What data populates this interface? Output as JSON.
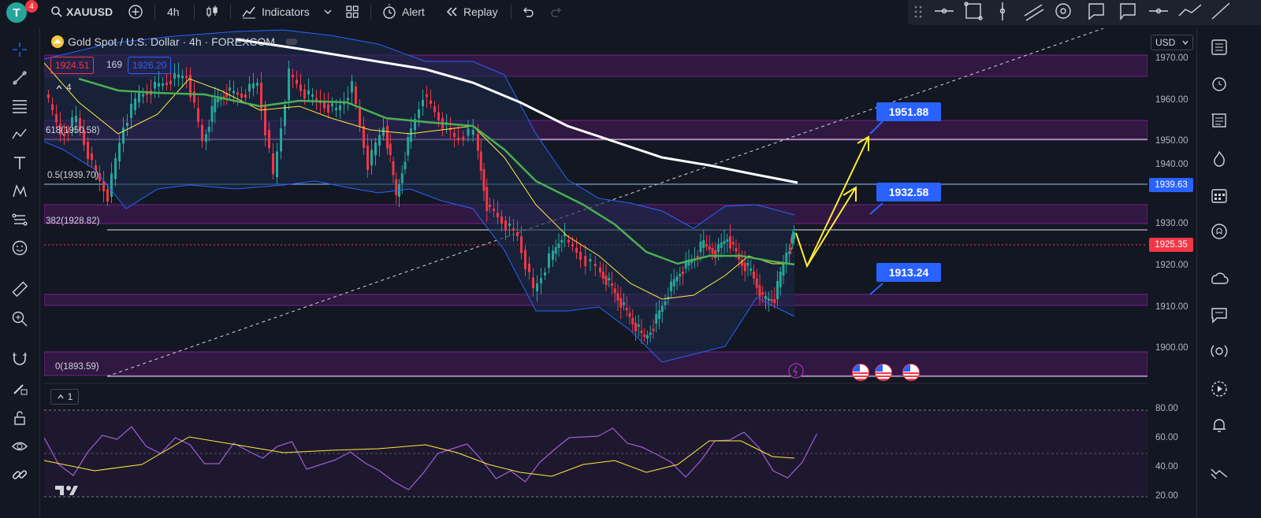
{
  "header": {
    "avatar_letter": "T",
    "notification_count": "4",
    "symbol": "XAUUSD",
    "interval": "4h",
    "indicators_label": "Indicators",
    "alert_label": "Alert",
    "replay_label": "Replay"
  },
  "legend": {
    "title": "Gold Spot / U.S. Dollar · 4h · FOREXCOM",
    "bid": "1924.51",
    "spread": "169",
    "ask": "1926.20",
    "indicator_count": "4"
  },
  "fib_labels": [
    "618(1950.58)",
    "0.5(1939.70)",
    "382(1928.82)",
    "0(1893.59)"
  ],
  "callouts": [
    "1951.88",
    "1932.58",
    "1913.24"
  ],
  "price_axis": {
    "currency": "USD",
    "ticks": [
      "1970.00",
      "1960.00",
      "1950.00",
      "1940.00",
      "1930.00",
      "1920.00",
      "1910.00",
      "1900.00"
    ],
    "marker_1939": "1939.63",
    "marker_price": "1925.35"
  },
  "rsi": {
    "legend": "1",
    "ticks": [
      "80.00",
      "60.00",
      "40.00",
      "20.00"
    ]
  },
  "colors": {
    "background": "#131722",
    "bull": "#26a69a",
    "bear": "#f23645",
    "accent": "#2962ff",
    "zone": "#6a1b9a",
    "projection": "#ffeb3b",
    "rsi": "#9c5fd6"
  },
  "icons": {
    "left_toolbar": [
      "crosshair-icon",
      "trendline-icon",
      "fib-icon",
      "pattern-icon",
      "text-icon",
      "xabcd-icon",
      "forecast-icon",
      "emoji-icon",
      "ruler-icon",
      "zoom-in-icon",
      "magnet-icon",
      "pencil-lock-icon",
      "lock-icon",
      "eye-icon",
      "link-icon"
    ],
    "right_toolbar": [
      "watchlist-icon",
      "alarm-icon",
      "data-window-icon",
      "hotlist-icon",
      "calendar-icon",
      "ideas-icon",
      "news-icon",
      "chat-icon",
      "signals-icon",
      "playback-icon",
      "alert-bell-icon",
      "trend-icon"
    ]
  }
}
